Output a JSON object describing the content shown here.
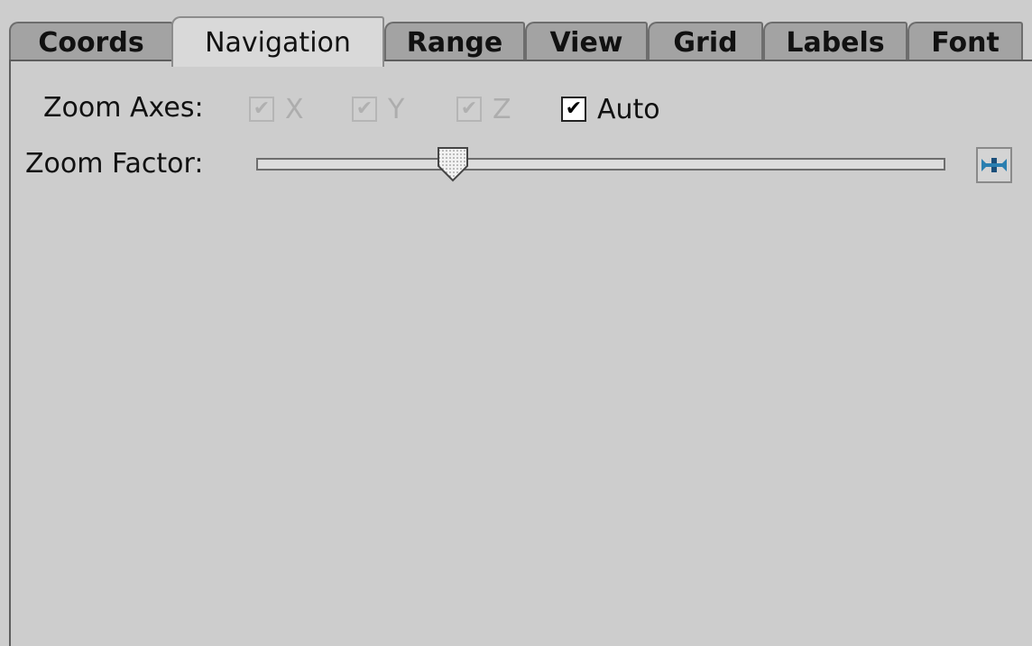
{
  "tabs": [
    {
      "label": "Coords",
      "active": false
    },
    {
      "label": "Navigation",
      "active": true
    },
    {
      "label": "Range",
      "active": false
    },
    {
      "label": "View",
      "active": false
    },
    {
      "label": "Grid",
      "active": false
    },
    {
      "label": "Labels",
      "active": false
    },
    {
      "label": "Font",
      "active": false
    }
  ],
  "zoom_axes": {
    "label": "Zoom Axes:",
    "x": {
      "label": "X",
      "checked": true,
      "enabled": false
    },
    "y": {
      "label": "Y",
      "checked": true,
      "enabled": false
    },
    "z": {
      "label": "Z",
      "checked": true,
      "enabled": false
    },
    "auto": {
      "label": "Auto",
      "checked": true,
      "enabled": true
    }
  },
  "zoom_factor": {
    "label": "Zoom Factor:",
    "slider_fraction": 0.285,
    "reset_icon": "reset-arrows-icon"
  },
  "colors": {
    "background": "#cdcdcd",
    "tab_inactive": "#a3a3a3",
    "tab_active": "#d9d9d9",
    "reset_icon_accent": "#2a7fb0"
  }
}
